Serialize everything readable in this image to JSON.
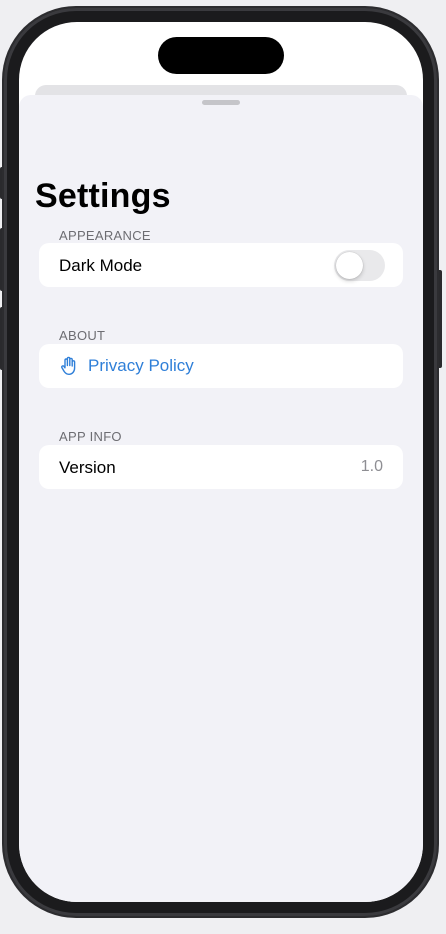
{
  "page": {
    "title": "Settings"
  },
  "sections": {
    "appearance": {
      "header": "APPEARANCE",
      "dark_mode_label": "Dark Mode",
      "dark_mode_enabled": false
    },
    "about": {
      "header": "ABOUT",
      "privacy_policy_label": "Privacy Policy",
      "privacy_icon": "hand-raised-icon"
    },
    "app_info": {
      "header": "APP INFO",
      "version_label": "Version",
      "version_value": "1.0"
    }
  },
  "colors": {
    "accent": "#2f7fd8",
    "background": "#f2f2f7",
    "secondary_text": "#8e8e93",
    "toggle_off": "#e9e9eb"
  }
}
